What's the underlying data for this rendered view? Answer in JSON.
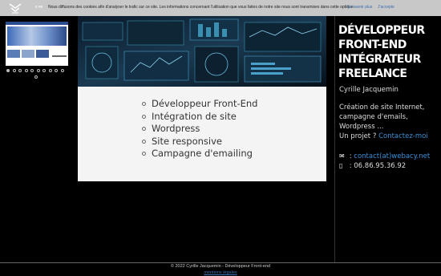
{
  "cookie_bar": {
    "partial_text": "ᴇ ᴘʀ",
    "message": "Nous diffusons des cookies afin d'analyser le trafic sur ce site. Les informations concernant l'utilisation que vous faites de notre site nous sont transmises dans cette optique.",
    "more_link": "En savoir plus",
    "accept_link": "J'accepte"
  },
  "slider": {
    "dot_count": 11,
    "active_index": 0
  },
  "services": [
    "Développeur Front-End",
    "Intégration de site",
    "Wordpress",
    "Site responsive",
    "Campagne d'emailing"
  ],
  "sidebar": {
    "headline": "Développeur Front-End Intégrateur Freelance",
    "owner": "Cyrille Jacquemin",
    "description": "Création de site Internet, campagne d'emails, Wordpress ...",
    "project_prompt": "Un projet ?",
    "contact_link": "Contactez-moi",
    "email_sep": ":",
    "email": "contact(at)webacy.net",
    "phone": ": 06.86.95.36.92"
  },
  "footer": {
    "copyright": "© 2022 Cyrille Jacquemin - Développeur Front-end",
    "legal_link": "mentions légales"
  },
  "colors": {
    "link": "#3a8fd8",
    "cookie_bg": "#c8c8c8",
    "content_bg": "#f4f4f4"
  }
}
